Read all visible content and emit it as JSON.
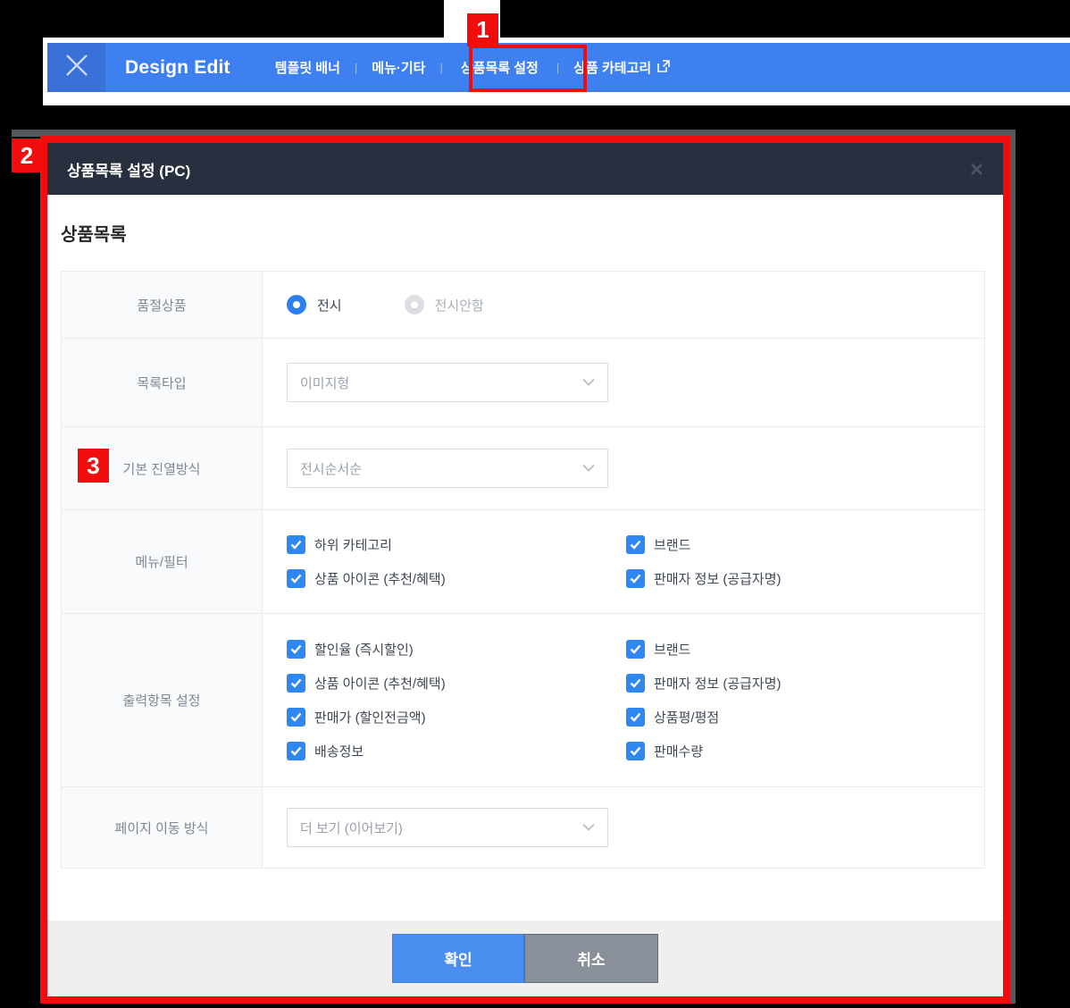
{
  "topbar": {
    "brand": "Design Edit",
    "nav": [
      {
        "label": "템플릿 배너"
      },
      {
        "label": "메뉴·기타"
      },
      {
        "label": "상품목록 설정",
        "highlighted": true
      },
      {
        "label": "상품 카테고리",
        "external": true
      }
    ]
  },
  "annotations": {
    "badge1": "1",
    "badge2": "2",
    "badge3": "3"
  },
  "modal": {
    "title": "상품목록 설정 (PC)",
    "close": "×",
    "section_title": "상품목록",
    "rows": [
      {
        "label": "품절상품",
        "type": "radio",
        "options": [
          {
            "label": "전시",
            "selected": true
          },
          {
            "label": "전시안함",
            "selected": false
          }
        ]
      },
      {
        "label": "목록타입",
        "type": "select",
        "value": "이미지형"
      },
      {
        "label": "기본 진열방식",
        "type": "select",
        "value": "전시순서순",
        "badge": "3"
      },
      {
        "label": "메뉴/필터",
        "type": "checkboxes",
        "items": [
          {
            "label": "하위 카테고리",
            "checked": true
          },
          {
            "label": "브랜드",
            "checked": true
          },
          {
            "label": "상품 아이콘 (추천/혜택)",
            "checked": true
          },
          {
            "label": "판매자 정보 (공급자명)",
            "checked": true
          }
        ]
      },
      {
        "label": "출력항목 설정",
        "type": "checkboxes",
        "items": [
          {
            "label": "할인율 (즉시할인)",
            "checked": true
          },
          {
            "label": "브랜드",
            "checked": true
          },
          {
            "label": "상품 아이콘 (추천/혜택)",
            "checked": true
          },
          {
            "label": "판매자 정보 (공급자명)",
            "checked": true
          },
          {
            "label": "판매가 (할인전금액)",
            "checked": true
          },
          {
            "label": "상품평/평점",
            "checked": true
          },
          {
            "label": "배송정보",
            "checked": true
          },
          {
            "label": "판매수량",
            "checked": true
          }
        ]
      },
      {
        "label": "페이지 이동 방식",
        "type": "select",
        "value": "더 보기 (이어보기)"
      }
    ],
    "footer": {
      "confirm": "확인",
      "cancel": "취소"
    }
  },
  "colors": {
    "topbar_blue": "#3e80f0",
    "topbar_tile_blue": "#3a71d8",
    "annotation_red": "#f10d0d",
    "modal_header_navy": "#28303f",
    "checkbox_blue": "#2f87f2",
    "radio_blue": "#2e80ef",
    "confirm_blue": "#4a8ef0",
    "cancel_gray": "#8a909a",
    "footer_gray": "#efefef"
  }
}
